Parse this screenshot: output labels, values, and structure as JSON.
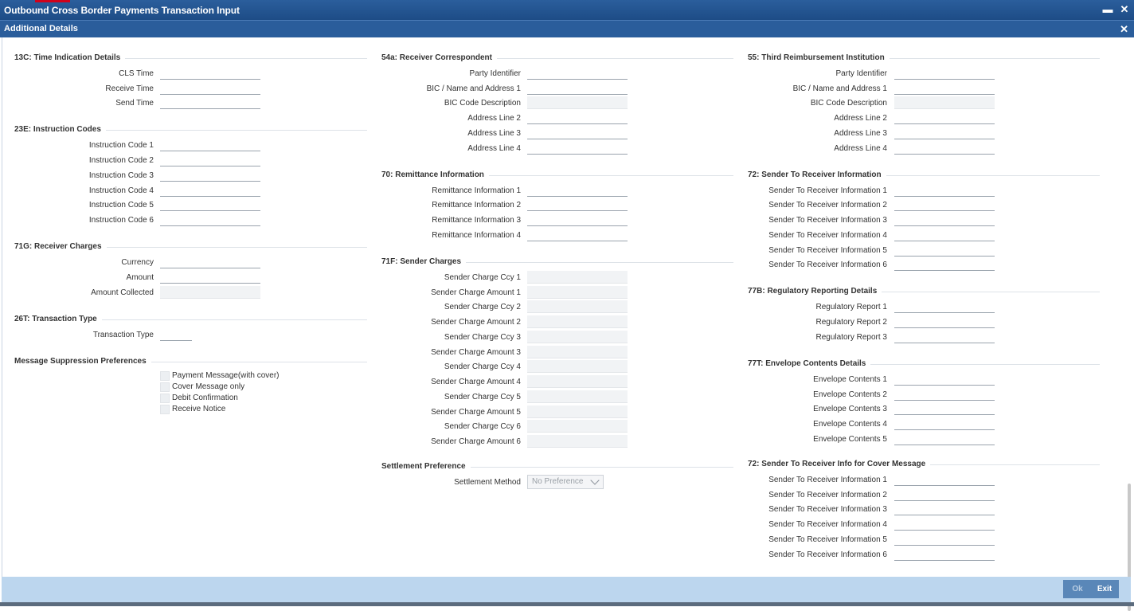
{
  "window": {
    "title": "Outbound Cross Border Payments Transaction Input",
    "minimize": "▬",
    "close": "✕"
  },
  "dialog": {
    "title": "Additional Details",
    "close": "✕"
  },
  "col1": {
    "time_indication": {
      "title": "13C: Time Indication Details",
      "fields": [
        {
          "label": "CLS Time",
          "value": ""
        },
        {
          "label": "Receive Time",
          "value": ""
        },
        {
          "label": "Send Time",
          "value": ""
        }
      ]
    },
    "instruction_codes": {
      "title": "23E: Instruction Codes",
      "fields": [
        {
          "label": "Instruction Code 1",
          "value": ""
        },
        {
          "label": "Instruction Code 2",
          "value": ""
        },
        {
          "label": "Instruction Code 3",
          "value": ""
        },
        {
          "label": "Instruction Code 4",
          "value": ""
        },
        {
          "label": "Instruction Code 5",
          "value": ""
        },
        {
          "label": "Instruction Code 6",
          "value": ""
        }
      ]
    },
    "receiver_charges": {
      "title": "71G: Receiver Charges",
      "fields": [
        {
          "label": "Currency",
          "value": ""
        },
        {
          "label": "Amount",
          "value": ""
        },
        {
          "label": "Amount Collected",
          "value": ""
        }
      ]
    },
    "transaction_type": {
      "title": "26T: Transaction Type",
      "fields": [
        {
          "label": "Transaction Type",
          "value": ""
        }
      ]
    },
    "suppression": {
      "title": "Message Suppression Preferences",
      "options": [
        {
          "label": "Payment Message(with cover)",
          "checked": false
        },
        {
          "label": "Cover Message only",
          "checked": false
        },
        {
          "label": "Debit Confirmation",
          "checked": false
        },
        {
          "label": "Receive Notice",
          "checked": false
        }
      ]
    }
  },
  "col2": {
    "receiver_correspondent": {
      "title": "54a: Receiver Correspondent",
      "fields": [
        {
          "label": "Party Identifier",
          "value": ""
        },
        {
          "label": "BIC / Name and Address 1",
          "value": ""
        },
        {
          "label": "BIC Code Description",
          "value": ""
        },
        {
          "label": "Address Line 2",
          "value": ""
        },
        {
          "label": "Address Line 3",
          "value": ""
        },
        {
          "label": "Address Line 4",
          "value": ""
        }
      ]
    },
    "remittance": {
      "title": "70: Remittance Information",
      "fields": [
        {
          "label": "Remittance Information 1",
          "value": ""
        },
        {
          "label": "Remittance Information 2",
          "value": ""
        },
        {
          "label": "Remittance Information 3",
          "value": ""
        },
        {
          "label": "Remittance Information 4",
          "value": ""
        }
      ]
    },
    "sender_charges": {
      "title": "71F: Sender Charges",
      "fields": [
        {
          "label": "Sender Charge Ccy 1",
          "value": ""
        },
        {
          "label": "Sender Charge Amount 1",
          "value": ""
        },
        {
          "label": "Sender Charge Ccy 2",
          "value": ""
        },
        {
          "label": "Sender Charge Amount 2",
          "value": ""
        },
        {
          "label": "Sender Charge Ccy 3",
          "value": ""
        },
        {
          "label": "Sender Charge Amount 3",
          "value": ""
        },
        {
          "label": "Sender Charge Ccy 4",
          "value": ""
        },
        {
          "label": "Sender Charge Amount 4",
          "value": ""
        },
        {
          "label": "Sender Charge Ccy 5",
          "value": ""
        },
        {
          "label": "Sender Charge Amount 5",
          "value": ""
        },
        {
          "label": "Sender Charge Ccy 6",
          "value": ""
        },
        {
          "label": "Sender Charge Amount 6",
          "value": ""
        }
      ]
    },
    "settlement": {
      "title": "Settlement Preference",
      "label": "Settlement Method",
      "value": "No Preference"
    }
  },
  "col3": {
    "third_reimbursement": {
      "title": "55: Third Reimbursement Institution",
      "fields": [
        {
          "label": "Party Identifier",
          "value": ""
        },
        {
          "label": "BIC / Name and Address 1",
          "value": ""
        },
        {
          "label": "BIC Code Description",
          "value": ""
        },
        {
          "label": "Address Line 2",
          "value": ""
        },
        {
          "label": "Address Line 3",
          "value": ""
        },
        {
          "label": "Address Line 4",
          "value": ""
        }
      ]
    },
    "sender_to_receiver": {
      "title": "72: Sender To Receiver Information",
      "fields": [
        {
          "label": "Sender To Receiver Information 1",
          "value": ""
        },
        {
          "label": "Sender To Receiver Information 2",
          "value": ""
        },
        {
          "label": "Sender To Receiver Information 3",
          "value": ""
        },
        {
          "label": "Sender To Receiver Information 4",
          "value": ""
        },
        {
          "label": "Sender To Receiver Information 5",
          "value": ""
        },
        {
          "label": "Sender To Receiver Information 6",
          "value": ""
        }
      ]
    },
    "regulatory": {
      "title": "77B: Regulatory Reporting Details",
      "fields": [
        {
          "label": "Regulatory Report 1",
          "value": ""
        },
        {
          "label": "Regulatory Report 2",
          "value": ""
        },
        {
          "label": "Regulatory Report 3",
          "value": ""
        }
      ]
    },
    "envelope": {
      "title": "77T: Envelope Contents Details",
      "fields": [
        {
          "label": "Envelope Contents 1",
          "value": ""
        },
        {
          "label": "Envelope Contents 2",
          "value": ""
        },
        {
          "label": "Envelope Contents 3",
          "value": ""
        },
        {
          "label": "Envelope Contents 4",
          "value": ""
        },
        {
          "label": "Envelope Contents 5",
          "value": ""
        }
      ]
    },
    "cover_message": {
      "title": "72: Sender To Receiver Info for Cover Message",
      "fields": [
        {
          "label": "Sender To Receiver Information 1",
          "value": ""
        },
        {
          "label": "Sender To Receiver Information 2",
          "value": ""
        },
        {
          "label": "Sender To Receiver Information 3",
          "value": ""
        },
        {
          "label": "Sender To Receiver Information 4",
          "value": ""
        },
        {
          "label": "Sender To Receiver Information 5",
          "value": ""
        },
        {
          "label": "Sender To Receiver Information 6",
          "value": ""
        }
      ]
    }
  },
  "footer": {
    "ok_label": "Ok",
    "exit_label": "Exit"
  }
}
